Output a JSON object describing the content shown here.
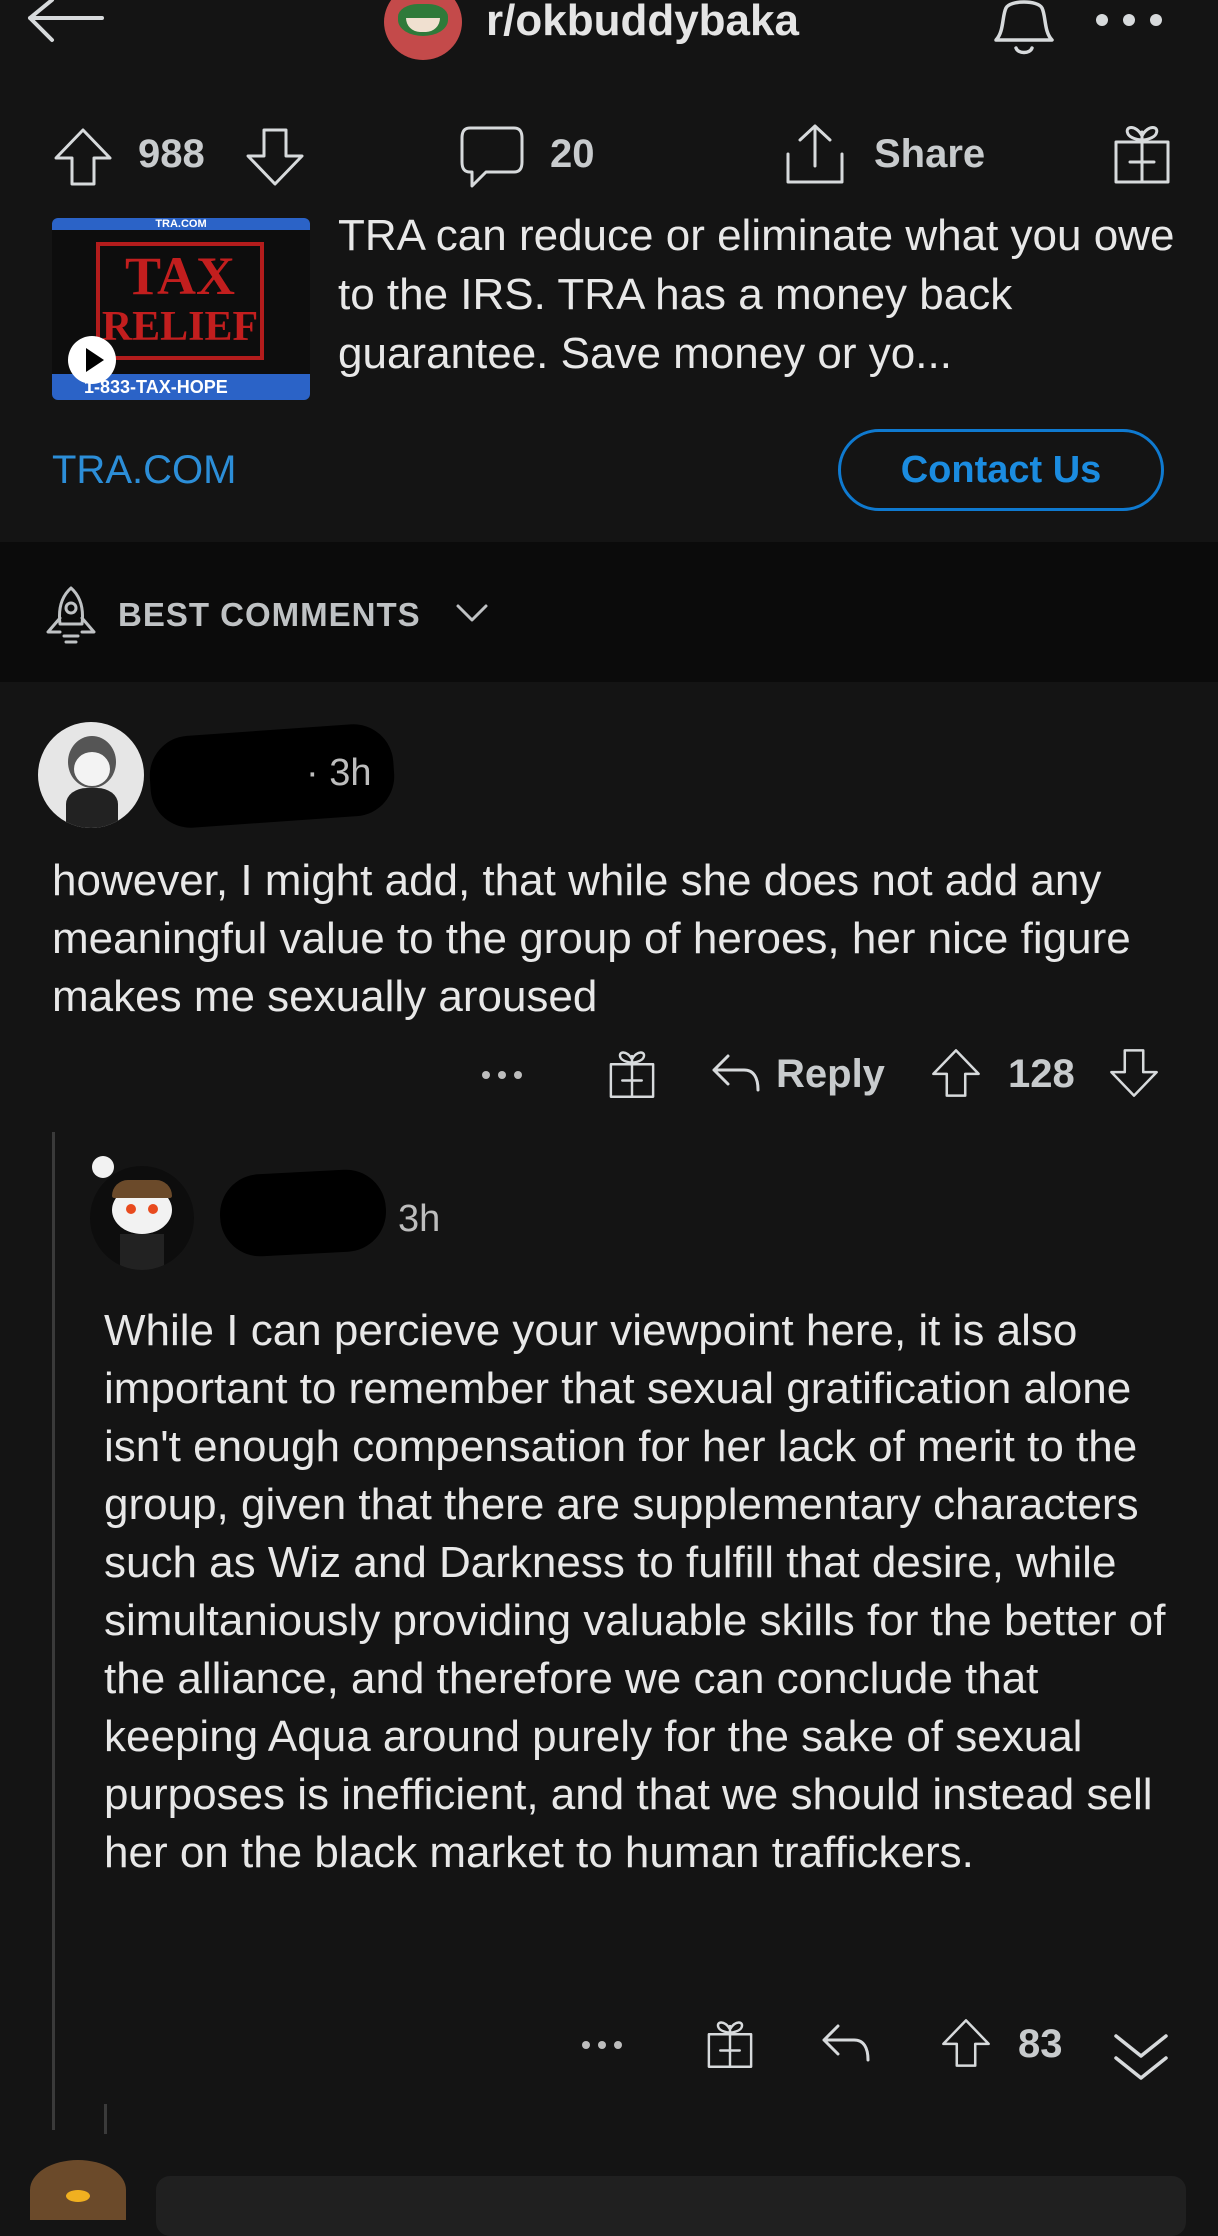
{
  "header": {
    "subreddit": "r/okbuddybaka"
  },
  "post": {
    "upvotes": "988",
    "comments": "20",
    "share_label": "Share"
  },
  "ad": {
    "thumb_banner": "TRA.COM",
    "thumb_title_line1": "TAX",
    "thumb_title_line2": "RELIEF",
    "thumb_phone": "1-833-TAX-HOPE",
    "text": "TRA can reduce or eliminate what you owe to the IRS. TRA has a money back guarantee. Save money or yo...",
    "domain": "TRA.COM",
    "cta": "Contact Us"
  },
  "sort": {
    "label": "BEST COMMENTS"
  },
  "comments": [
    {
      "time": "· 3h",
      "text": "however, I might add, that while she does not add any meaningful value to the group of heroes, her nice figure makes me sexually aroused",
      "reply_label": "Reply",
      "score": "128",
      "more": "···"
    },
    {
      "time": "3h",
      "text": "While I can percieve your viewpoint here, it is also important to remember that sexual gratification alone isn't enough compensation for her lack of merit to the group, given that there are supplementary characters such as Wiz and Darkness to fulfill that desire, while simultaniously providing valuable skills for the better of the alliance, and therefore we can conclude that keeping Aqua around purely for the sake of sexual purposes is inefficient, and that we should instead sell her on the black market to human traffickers.",
      "score": "83",
      "more": "···"
    }
  ],
  "colors": {
    "background": "#141414",
    "accent": "#1b8ce0",
    "text": "#e8e8e8"
  }
}
